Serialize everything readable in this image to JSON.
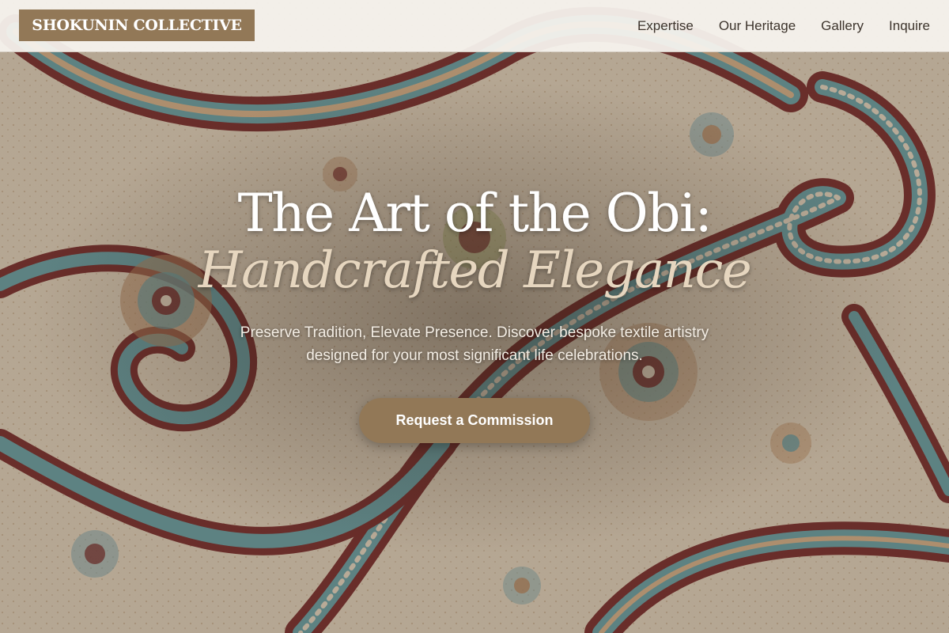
{
  "header": {
    "logo_text": "SHOKUNIN COLLECTIVE",
    "nav": [
      {
        "label": "Expertise"
      },
      {
        "label": "Our Heritage"
      },
      {
        "label": "Gallery"
      },
      {
        "label": "Inquire"
      }
    ]
  },
  "hero": {
    "title_line1": "The Art of the Obi:",
    "title_line2": "Handcrafted Elegance",
    "description": "Preserve Tradition, Elevate Presence. Discover bespoke textile artistry designed for your most significant life celebrations.",
    "cta_label": "Request a Commission",
    "background_image": "paisley-textile-pattern"
  },
  "colors": {
    "brand": "#927857",
    "header_bg": "#f6f3ee",
    "nav_text": "#3d342c",
    "title": "#ffffff",
    "subtitle": "#e6d6bf",
    "paisley_red": "#7a2e2e",
    "paisley_teal": "#6aa3a9",
    "paisley_tan": "#c9a07a",
    "fabric_cream": "#ece0cd"
  }
}
